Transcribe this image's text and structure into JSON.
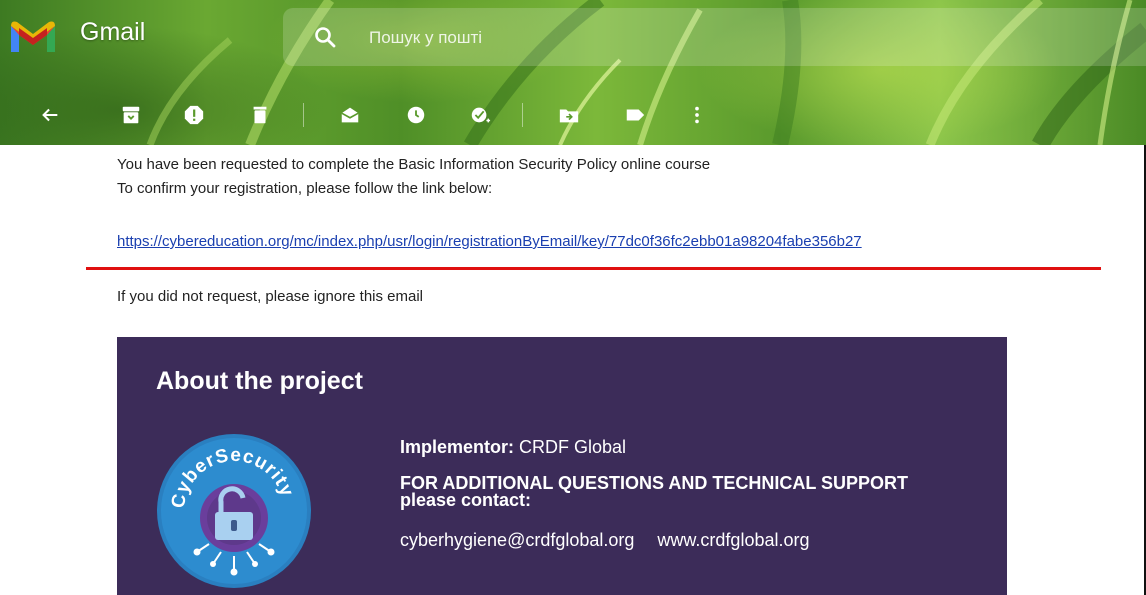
{
  "app": {
    "title": "Gmail"
  },
  "search": {
    "placeholder": "Пошук у пошті"
  },
  "toolbar": {
    "items": [
      "back-icon",
      "archive-icon",
      "report-spam-icon",
      "delete-icon",
      "mark-unread-icon",
      "snooze-icon",
      "add-to-tasks-icon",
      "move-to-icon",
      "label-icon",
      "more-options-icon"
    ]
  },
  "message": {
    "line1": "You have been requested to complete the Basic Information Security Policy online course",
    "line2": "To confirm your registration, please follow the link below:",
    "link": "https://cybereducation.org/mc/index.php/usr/login/registrationByEmail/key/77dc0f36fc2ebb01a98204fabe356b27",
    "ignore": "If you did not request, please ignore this email",
    "highlight_color": "#e01010"
  },
  "banner": {
    "title": "About the project",
    "logo_text": "CyberSecurity",
    "implementor_label": "Implementor:",
    "implementor_value": "CRDF Global",
    "contact_title": "FOR ADDITIONAL QUESTIONS AND TECHNICAL SUPPORT please contact:",
    "email": "cyberhygiene@crdfglobal.org",
    "website": "www.crdfglobal.org",
    "background_color": "#3c2c59"
  }
}
